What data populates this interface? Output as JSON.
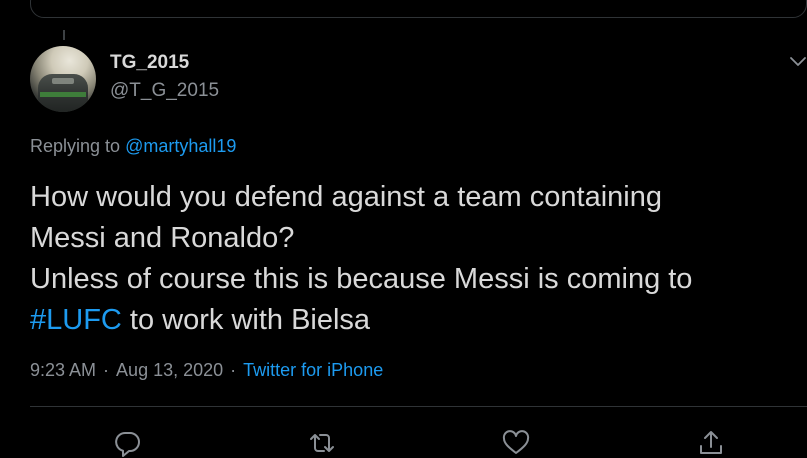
{
  "tweet": {
    "author": {
      "display_name": "TG_2015",
      "handle": "@T_G_2015"
    },
    "replying_to": {
      "prefix": "Replying to",
      "mention": "@martyhall19"
    },
    "text": {
      "line1": "How would you defend against a team containing",
      "line2": "Messi and Ronaldo?",
      "line3": "Unless of course this is because Messi is coming to",
      "hashtag": "#LUFC",
      "line4_rest": " to work with Bielsa"
    },
    "meta": {
      "time": "9:23 AM",
      "separator": "·",
      "date": "Aug 13, 2020",
      "source": "Twitter for iPhone"
    },
    "actions": [
      {
        "name": "reply",
        "icon": "reply-icon"
      },
      {
        "name": "retweet",
        "icon": "retweet-icon"
      },
      {
        "name": "like",
        "icon": "heart-icon"
      },
      {
        "name": "share",
        "icon": "share-icon"
      }
    ]
  },
  "colors": {
    "background": "#000000",
    "text": "#d9d9d9",
    "muted": "#8b9096",
    "accent": "#1d9bf0",
    "border": "#2f3336"
  }
}
